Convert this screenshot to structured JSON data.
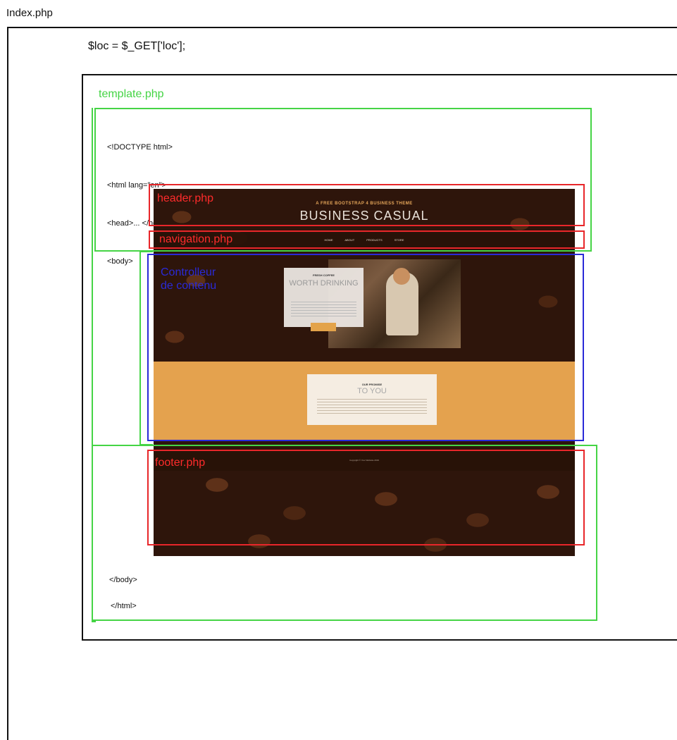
{
  "index": {
    "filename": "Index.php",
    "code_line": "$loc = $_GET['loc'];"
  },
  "template": {
    "filename": "template.php",
    "head_code": [
      "<!DOCTYPE html>",
      "<html lang=\"en\">",
      "<head>... </head>",
      "<body>"
    ],
    "close_body": "</body>",
    "close_html": "</html>"
  },
  "regions": {
    "header": "header.php",
    "navigation": "navigation.php",
    "controller": "Controlleur\nde contenu",
    "footer": "footer.php"
  },
  "site": {
    "header_small": "A FREE BOOTSTRAP 4 BUSINESS THEME",
    "header_title": "BUSINESS CASUAL",
    "nav_links": "HOME ABOUT PRODUCTS STORE",
    "card1_small": "FRESH COFFEE",
    "card1_title": "WORTH DRINKING",
    "card2_small": "OUR PROMISE",
    "card2_title": "TO YOU",
    "footer_copy": "Copyright © Your Website 2019"
  },
  "colors": {
    "template_box": "#45d445",
    "partial_box": "#e8262a",
    "controller_box": "#2a2ad8"
  }
}
